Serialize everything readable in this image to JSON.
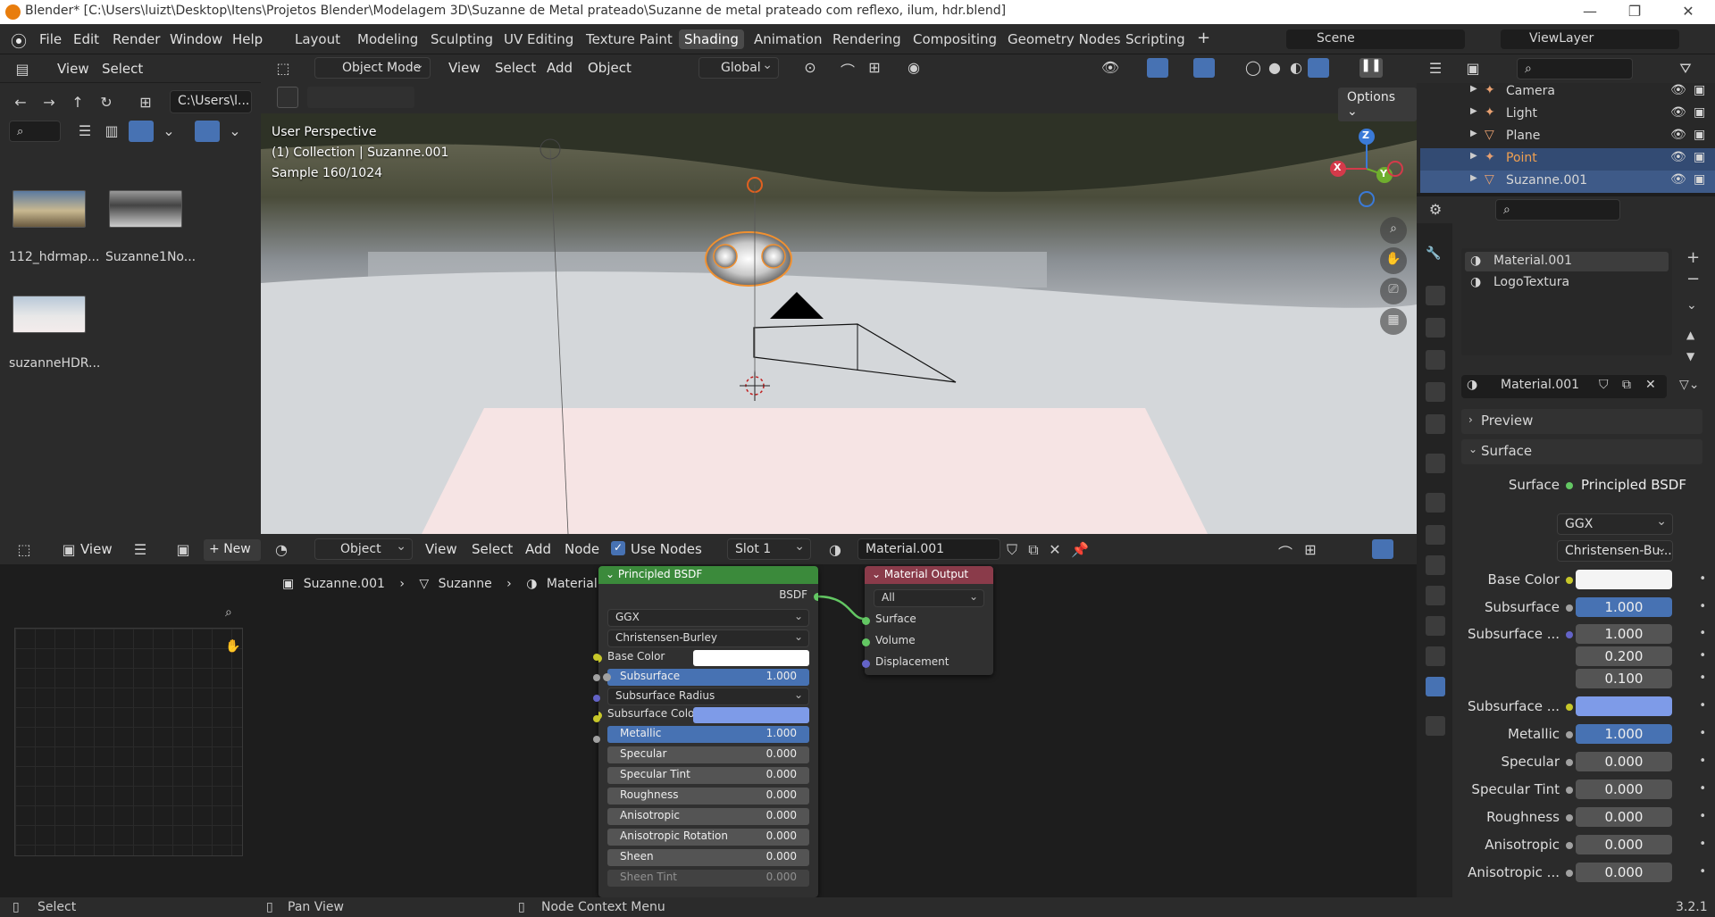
{
  "window": {
    "title": "Blender* [C:\\Users\\luizt\\Desktop\\Itens\\Projetos Blender\\Modelagem 3D\\Suzanne de Metal prateado\\Suzanne de metal prateado com reflexo, ilum, hdr.blend]",
    "minimize": "—",
    "maximize": "❐",
    "close": "✕"
  },
  "menu": [
    "File",
    "Edit",
    "Render",
    "Window",
    "Help"
  ],
  "workspaces": [
    "Layout",
    "Modeling",
    "Sculpting",
    "UV Editing",
    "Texture Paint",
    "Shading",
    "Animation",
    "Rendering",
    "Compositing",
    "Geometry Nodes",
    "Scripting",
    "+"
  ],
  "active_workspace": "Shading",
  "scene": {
    "label": "Scene",
    "view_layer": "ViewLayer"
  },
  "file_browser": {
    "menu": [
      "View",
      "Select"
    ],
    "path": "C:\\Users\\l...",
    "files": [
      "112_hdrmap...",
      "Suzanne1No...",
      "suzanneHDR..."
    ]
  },
  "viewport": {
    "mode": "Object Mode",
    "menu": [
      "View",
      "Select",
      "Add",
      "Object"
    ],
    "transform": "Global",
    "options": "Options",
    "overlay_lines": [
      "User Perspective",
      "(1) Collection | Suzanne.001",
      "Sample 160/1024"
    ],
    "gizmo": {
      "x": "X",
      "y": "Y",
      "z": "Z"
    }
  },
  "outliner": {
    "items": [
      {
        "name": "Camera",
        "color": "#dddddd"
      },
      {
        "name": "Light",
        "color": "#dddddd"
      },
      {
        "name": "Plane",
        "color": "#dddddd"
      },
      {
        "name": "Point",
        "color": "#f0a050"
      },
      {
        "name": "Suzanne.001",
        "color": "#dddddd"
      }
    ]
  },
  "properties": {
    "materials": [
      "Material.001",
      "LogoTextura"
    ],
    "material_name": "Material.001",
    "sections": {
      "preview": "Preview",
      "surface": "Surface"
    },
    "surface_label": "Surface",
    "surface_value": "Principled BSDF",
    "distribution": "GGX",
    "subsurface_method": "Christensen-Bu...",
    "rows": [
      {
        "label": "Base Color",
        "value": "",
        "kind": "white",
        "dot": "#c7c729"
      },
      {
        "label": "Subsurface",
        "value": "1.000",
        "kind": "blue",
        "dot": "#a1a1a1"
      },
      {
        "label": "Subsurface ...",
        "value": "1.000",
        "kind": "gray",
        "dot": "#6363c7"
      },
      {
        "label": "",
        "value": "0.200",
        "kind": "gray",
        "dot": ""
      },
      {
        "label": "",
        "value": "0.100",
        "kind": "gray",
        "dot": ""
      },
      {
        "label": "Subsurface ...",
        "value": "",
        "kind": "lavender",
        "dot": "#c7c729"
      },
      {
        "label": "Metallic",
        "value": "1.000",
        "kind": "blue",
        "dot": "#a1a1a1"
      },
      {
        "label": "Specular",
        "value": "0.000",
        "kind": "gray",
        "dot": "#a1a1a1"
      },
      {
        "label": "Specular Tint",
        "value": "0.000",
        "kind": "gray",
        "dot": "#a1a1a1"
      },
      {
        "label": "Roughness",
        "value": "0.000",
        "kind": "gray",
        "dot": "#a1a1a1"
      },
      {
        "label": "Anisotropic",
        "value": "0.000",
        "kind": "gray",
        "dot": "#a1a1a1"
      },
      {
        "label": "Anisotropic ...",
        "value": "0.000",
        "kind": "gray",
        "dot": "#a1a1a1"
      }
    ]
  },
  "image_editor": {
    "view": "View",
    "new": "New"
  },
  "node_editor": {
    "type": "Object",
    "menu": [
      "View",
      "Select",
      "Add",
      "Node"
    ],
    "use_nodes": "Use Nodes",
    "slot": "Slot 1",
    "material": "Material.001",
    "breadcrumb": [
      "Suzanne.001",
      "Suzanne",
      "Material.001"
    ],
    "bsdf_node": {
      "title": "Principled BSDF",
      "output": "BSDF",
      "distribution": "GGX",
      "subsurface_method": "Christensen-Burley",
      "base_color": "Base Color",
      "subsurface_radius": "Subsurface Radius",
      "subsurface_color": "Subsurface Colo",
      "sliders": [
        {
          "label": "Subsurface",
          "value": "1.000",
          "blue": true
        },
        {
          "label": "Metallic",
          "value": "1.000",
          "blue": true
        },
        {
          "label": "Specular",
          "value": "0.000",
          "blue": false
        },
        {
          "label": "Specular Tint",
          "value": "0.000",
          "blue": false
        },
        {
          "label": "Roughness",
          "value": "0.000",
          "blue": false
        },
        {
          "label": "Anisotropic",
          "value": "0.000",
          "blue": false
        },
        {
          "label": "Anisotropic Rotation",
          "value": "0.000",
          "blue": false
        },
        {
          "label": "Sheen",
          "value": "0.000",
          "blue": false
        },
        {
          "label": "Sheen Tint",
          "value": "0.000",
          "blue": false
        }
      ]
    },
    "output_node": {
      "title": "Material Output",
      "target": "All",
      "inputs": [
        "Surface",
        "Volume",
        "Displacement"
      ]
    }
  },
  "status": {
    "select": "Select",
    "pan": "Pan View",
    "context": "Node Context Menu",
    "version": "3.2.1"
  },
  "colors": {
    "accent_blue": "#4772b3",
    "selection": "#334b73",
    "node_header_green": "#3b8a3b",
    "node_header_red": "#8a3b4a",
    "socket_green": "#63c763"
  }
}
